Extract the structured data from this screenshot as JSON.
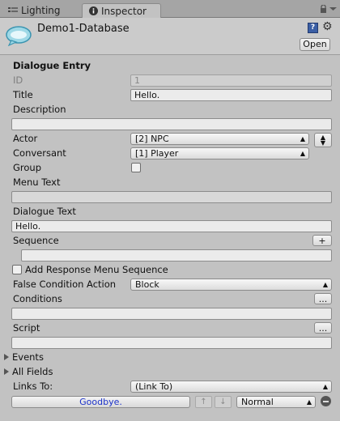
{
  "tabs": [
    {
      "label": "Lighting"
    },
    {
      "label": "Inspector"
    }
  ],
  "header": {
    "title": "Demo1-Database",
    "open_label": "Open"
  },
  "entry": {
    "section_title": "Dialogue Entry",
    "id_label": "ID",
    "id_value": "1",
    "title_label": "Title",
    "title_value": "Hello.",
    "description_label": "Description",
    "description_value": "",
    "actor_label": "Actor",
    "actor_value": "[2] NPC",
    "conversant_label": "Conversant",
    "conversant_value": "[1] Player",
    "group_label": "Group",
    "group_checked": false,
    "menu_text_label": "Menu Text",
    "menu_text_value": "",
    "dialogue_text_label": "Dialogue Text",
    "dialogue_text_value": "Hello.",
    "sequence_label": "Sequence",
    "sequence_add": "+",
    "sequence_value": "",
    "add_response_label": "Add Response Menu Sequence",
    "add_response_checked": false,
    "false_condition_label": "False Condition Action",
    "false_condition_value": "Block",
    "conditions_label": "Conditions",
    "conditions_more": "...",
    "conditions_value": "",
    "script_label": "Script",
    "script_more": "...",
    "script_value": "",
    "events_label": "Events",
    "all_fields_label": "All Fields",
    "links_to_label": "Links To:",
    "links_to_value": "(Link To)",
    "link_item_label": "Goodbye.",
    "move_up": "↑",
    "move_down": "↓",
    "priority_value": "Normal"
  }
}
